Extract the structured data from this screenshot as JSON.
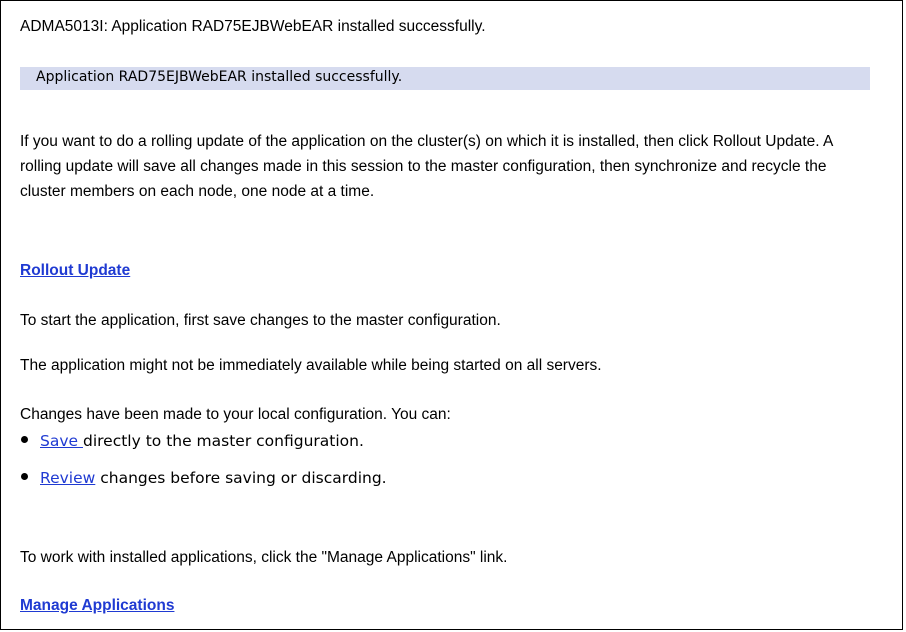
{
  "message_id_line": "ADMA5013I: Application RAD75EJBWebEAR installed successfully.",
  "banner_text": "Application RAD75EJBWebEAR installed successfully.",
  "rolling_update_paragraph": "If you want to do a rolling update of the application on the cluster(s) on which it is installed, then click Rollout Update. A rolling update will save all changes made in this session to the master configuration, then synchronize and recycle the cluster members on each node, one node at a time.",
  "rollout_link_label": "Rollout Update",
  "start_text": "To start the application, first save changes to the master configuration.",
  "availability_text": "The application might not be immediately available while being started on all servers.",
  "changes_text": "Changes have been made to your local configuration. You can:",
  "options": [
    {
      "link": "Save ",
      "rest": "directly to the master configuration."
    },
    {
      "link": "Review",
      "rest": " changes before saving or discarding."
    }
  ],
  "work_with_text": "To work with installed applications, click the \"Manage Applications\" link.",
  "manage_link_label": "Manage Applications",
  "colors": {
    "link": "#1f3ad2",
    "banner_bg": "#d6dbef",
    "border": "#000000"
  },
  "icons": [
    "bullet-icon"
  ]
}
